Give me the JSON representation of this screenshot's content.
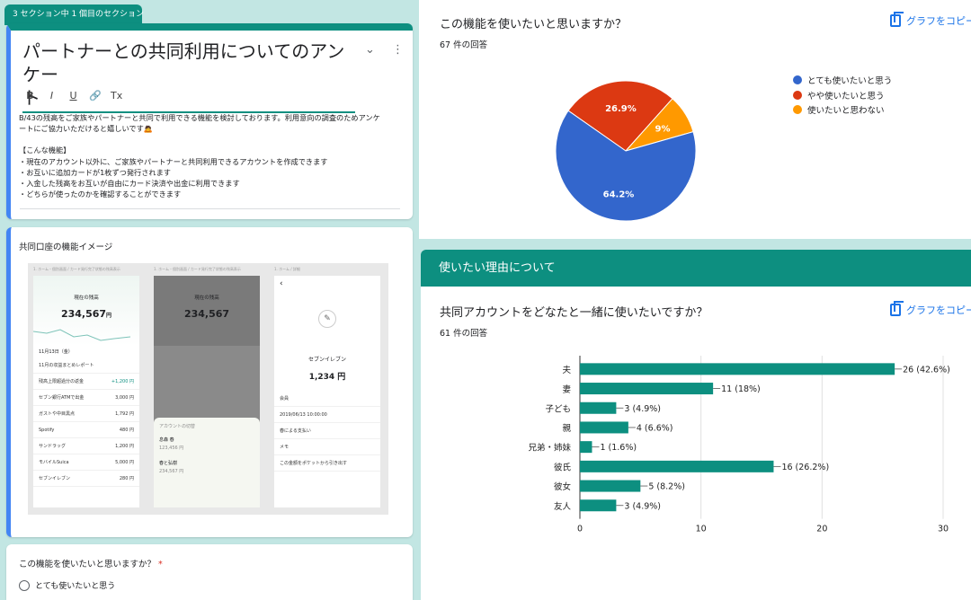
{
  "form": {
    "section_tag": "3 セクション中 1 個目のセクション",
    "title_line1": "パートナーとの共同利用についてのアンケー",
    "title_line2": "ト",
    "format_icons": [
      "B",
      "I",
      "U",
      "🔗",
      "Tx"
    ],
    "description": [
      "B/43の残高をご家族やパートナーと共同で利用できる機能を検討しております。利用意向の調査のためアンケ",
      "ートにご協力いただけると嬉しいです🙇",
      "",
      "【こんな機能】",
      "・現在のアカウント以外に、ご家族やパートナーと共同利用できるアカウントを作成できます",
      "・お互いに追加カードが1枚ずつ発行されます",
      "・入金した残高をお互いが自由にカード決済や出金に利用できます",
      "・どちらが使ったのかを確認することができます"
    ],
    "image_title": "共同口座の機能イメージ",
    "question_label": "この機能を使いたいと思いますか？",
    "question_required": "*",
    "first_option": "とても使いたいと思う"
  },
  "mockup": {
    "screen1": {
      "crumb": "1. ホーム・個別画面 / カード発行完了状態の残高表示",
      "label": "現在の残高",
      "amount": "234,567",
      "unit": "円",
      "date": "11月13日（金）",
      "rows": [
        {
          "name": "11月の収益まとめレポート",
          "val": ""
        },
        {
          "name": "残高上限超過分の返金",
          "val": "+1,200 円"
        },
        {
          "name": "セブン銀行ATMで出金",
          "val": "3,000 円"
        },
        {
          "name": "ガストや中目黒点",
          "val": "1,792 円"
        },
        {
          "name": "Spotify",
          "val": "480 円"
        },
        {
          "name": "サンドラッグ",
          "val": "1,200 円"
        },
        {
          "name": "モバイルSuica",
          "val": "5,000 円"
        },
        {
          "name": "セブンイレブン",
          "val": "280 円"
        }
      ]
    },
    "screen2": {
      "crumb": "1. ホーム・個別画面 / カード発行完了状態の残高表示",
      "label": "現在の残高",
      "amount": "234,567",
      "sheet_title": "アカウントの切替",
      "acct1": "息森 春",
      "acct1_amt": "123,456 円",
      "acct2": "春と弘樹",
      "acct2_amt": "234,567 円"
    },
    "screen3": {
      "crumb": "1. ホーム / 詳細",
      "name": "セブンイレブン",
      "amount": "1,234 円",
      "rows": [
        "会員",
        "2019/06/13 10:00:00",
        "春による支払い",
        "メモ",
        "この金額をポケットから引き出す"
      ]
    }
  },
  "responses": {
    "copy_label": "グラフをコピー",
    "q1": {
      "title": "この機能を使いたいと思いますか？",
      "count": "67 件の回答"
    },
    "section_band": "使いたい理由について",
    "q2": {
      "title": "共同アカウントをどなたと一緒に使いたいですか？",
      "count": "61 件の回答"
    }
  },
  "chart_data": [
    {
      "type": "pie",
      "labels": [
        "とても使いたいと思う",
        "やや使いたいと思う",
        "使いたいと思わない"
      ],
      "values": [
        64.2,
        26.9,
        9
      ],
      "value_labels": [
        "64.2%",
        "26.9%",
        "9%"
      ],
      "colors": [
        "#3366cc",
        "#dc3912",
        "#ff9900"
      ],
      "legend": "right"
    },
    {
      "type": "bar",
      "orientation": "horizontal",
      "categories": [
        "夫",
        "妻",
        "子ども",
        "親",
        "兄弟・姉妹",
        "彼氏",
        "彼女",
        "友人"
      ],
      "values": [
        26,
        11,
        3,
        4,
        1,
        16,
        5,
        3
      ],
      "value_labels": [
        "26 (42.6%)",
        "11 (18%)",
        "3 (4.9%)",
        "4 (6.6%)",
        "1 (1.6%)",
        "16 (26.2%)",
        "5 (8.2%)",
        "3 (4.9%)"
      ],
      "xlim": [
        0,
        30
      ],
      "xticks": [
        0,
        10,
        20,
        30
      ],
      "color": "#0d8f80",
      "grid": true
    }
  ]
}
